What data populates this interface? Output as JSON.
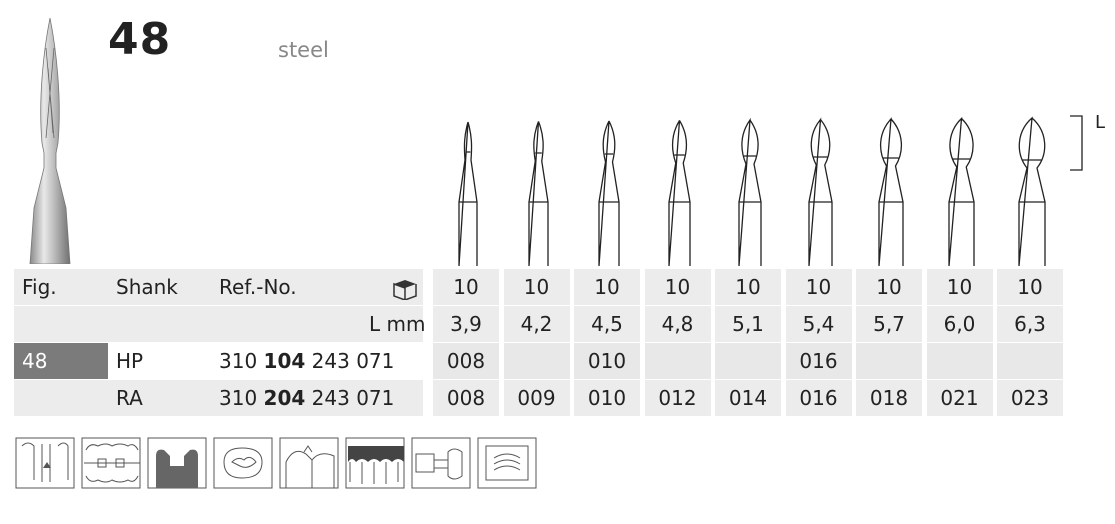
{
  "figure": {
    "number": "48",
    "material": "steel"
  },
  "dimension_label": "L",
  "table": {
    "header": {
      "fig": "Fig.",
      "shank": "Shank",
      "ref_no": "Ref.-No.",
      "package_icon": "package-box-icon"
    },
    "quantities": [
      "10",
      "10",
      "10",
      "10",
      "10",
      "10",
      "10",
      "10",
      "10"
    ],
    "length_label": "L mm",
    "lengths": [
      "3,9",
      "4,2",
      "4,5",
      "4,8",
      "5,1",
      "5,4",
      "5,7",
      "6,0",
      "6,3"
    ],
    "rows": [
      {
        "fig": "48",
        "shank": "HP",
        "ref_prefix": "310",
        "ref_bold": "104",
        "ref_suffix": "243 071",
        "sizes": [
          "008",
          "",
          "010",
          "",
          "",
          "016",
          "",
          "",
          ""
        ]
      },
      {
        "fig": "",
        "shank": "RA",
        "ref_prefix": "310",
        "ref_bold": "204",
        "ref_suffix": "243 071",
        "sizes": [
          "008",
          "009",
          "010",
          "012",
          "014",
          "016",
          "018",
          "021",
          "023"
        ]
      }
    ]
  },
  "application_icons": [
    "anterior-cavity-icon",
    "crown-prep-icon",
    "cavity-form-icon",
    "occlusal-icon",
    "tooth-contour-icon",
    "gingiva-icon",
    "bridge-icon",
    "finishing-icon"
  ],
  "colors": {
    "fig_cell": "#7b7b7b",
    "row_bg": "#ececec",
    "row_bg_alt": "#e2e2e2"
  }
}
